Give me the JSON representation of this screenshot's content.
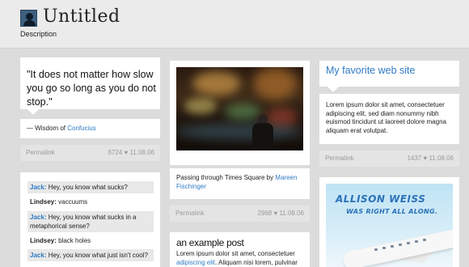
{
  "header": {
    "title": "Untitled",
    "description": "Description"
  },
  "quote_post": {
    "text": "\"It does not matter how slow you go so long as you do not stop.\"",
    "source_prefix": "— Wisdom of ",
    "source_link": "Confucius",
    "permalink": "Permalink",
    "meta": "6724 ♥ 11.08.06"
  },
  "chat_post": {
    "lines": [
      {
        "name": "Jack:",
        "text": " Hey, you know what sucks?"
      },
      {
        "name": "Lindsey:",
        "text": " vaccuums"
      },
      {
        "name": "Jack:",
        "text": " Hey, you know what sucks in a metaphorical sense?"
      },
      {
        "name": "Lindsey:",
        "text": " black holes"
      },
      {
        "name": "Jack:",
        "text": " Hey, you know what just isn't cool?"
      }
    ]
  },
  "photo_post": {
    "caption_prefix": "Passing through Times Square by ",
    "caption_link": "Mareen Fischinger",
    "permalink": "Permalink",
    "meta": "2968 ♥ 11.08.06"
  },
  "text_post": {
    "title": "an example post",
    "body_prefix": "Lorem ipsum dolor sit amet, consectetuer ",
    "body_link": "adipiscing elit",
    "body_suffix": ". Aliquam nisi lorem, pulvinar"
  },
  "link_post": {
    "title": "My favorite web site",
    "body": "Lorem ipsum dolor sit amet, consectetuer adipiscing elit, sed diam nonummy nibh euismod tincidunt ut laoreet dolore magna aliquam erat volutpat.",
    "permalink": "Permalink",
    "meta": "1437 ♥ 11.08.06"
  },
  "ad": {
    "title": "ALLISON WEISS",
    "subtitle": "WAS RIGHT ALL ALONG."
  }
}
